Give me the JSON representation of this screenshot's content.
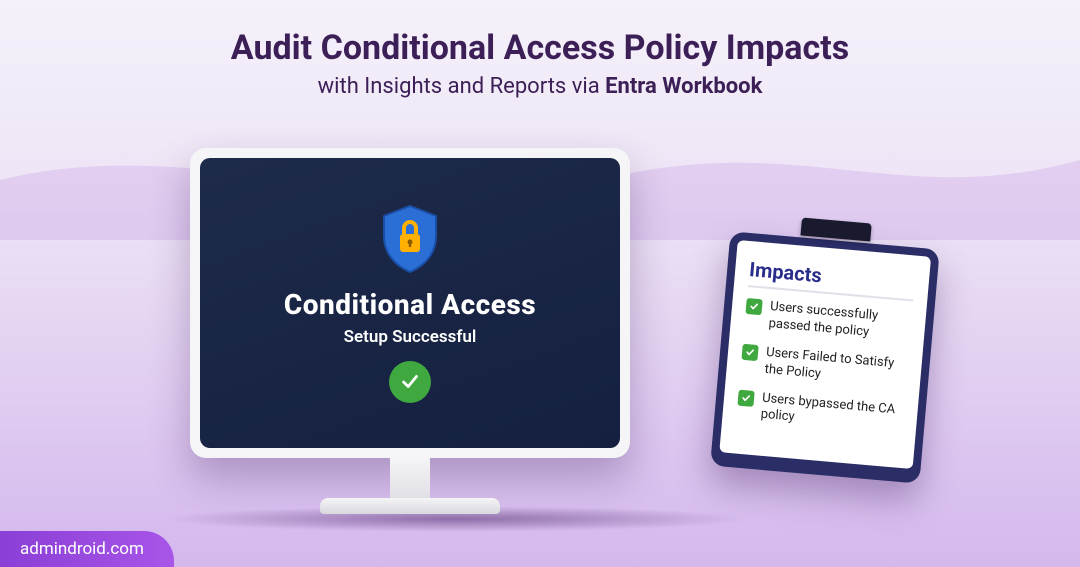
{
  "header": {
    "title": "Audit Conditional Access Policy Impacts",
    "subtitle_prefix": "with Insights and Reports via ",
    "subtitle_bold": "Entra Workbook"
  },
  "monitor": {
    "heading": "Conditional Access",
    "status": "Setup Successful"
  },
  "clipboard": {
    "title": "Impacts",
    "items": [
      "Users successfully passed the policy",
      "Users Failed to Satisfy the Policy",
      "Users bypassed the CA policy"
    ]
  },
  "brand": "admindroid.com",
  "colors": {
    "shield": "#2b6fd6",
    "lock": "#ffb000",
    "check": "#3fa83f"
  }
}
